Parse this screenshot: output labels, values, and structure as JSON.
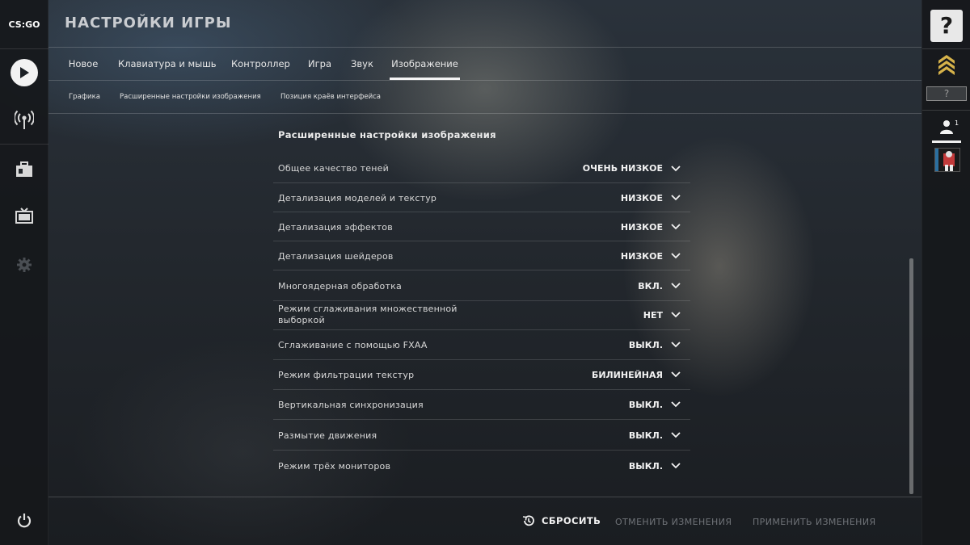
{
  "app": {
    "logo_text": "CS:GO",
    "title": "НАСТРОЙКИ ИГРЫ"
  },
  "sidebar": {
    "items": [
      {
        "name": "play",
        "icon": "play-icon"
      },
      {
        "name": "broadcast",
        "icon": "antenna-icon"
      },
      {
        "name": "inventory",
        "icon": "briefcase-icon"
      },
      {
        "name": "watch",
        "icon": "tv-icon"
      },
      {
        "name": "settings",
        "icon": "gear-icon"
      },
      {
        "name": "quit",
        "icon": "power-icon"
      }
    ]
  },
  "rightbar": {
    "help_label": "?",
    "rank_unknown": "?",
    "friends_count": "1"
  },
  "tabs": [
    {
      "label": "Новое",
      "active": false
    },
    {
      "label": "Клавиатура и мышь",
      "active": false
    },
    {
      "label": "Контроллер",
      "active": false
    },
    {
      "label": "Игра",
      "active": false
    },
    {
      "label": "Звук",
      "active": false
    },
    {
      "label": "Изображение",
      "active": true
    }
  ],
  "subtabs": [
    {
      "label": "Графика"
    },
    {
      "label": "Расширенные настройки изображения"
    },
    {
      "label": "Позиция краёв интерфейса"
    }
  ],
  "section": {
    "title": "Расширенные настройки изображения"
  },
  "settings": [
    {
      "label": "Общее качество теней",
      "value": "ОЧЕНЬ НИЗКОЕ"
    },
    {
      "label": "Детализация моделей и текстур",
      "value": "НИЗКОЕ"
    },
    {
      "label": "Детализация эффектов",
      "value": "НИЗКОЕ"
    },
    {
      "label": "Детализация шейдеров",
      "value": "НИЗКОЕ"
    },
    {
      "label": "Многоядерная обработка",
      "value": "ВКЛ."
    },
    {
      "label": "Режим сглаживания множественной выборкой",
      "value": "НЕТ"
    },
    {
      "label": "Сглаживание с помощью FXAA",
      "value": "ВЫКЛ."
    },
    {
      "label": "Режим фильтрации текстур",
      "value": "БИЛИНЕЙНАЯ"
    },
    {
      "label": "Вертикальная синхронизация",
      "value": "ВЫКЛ."
    },
    {
      "label": "Размытие движения",
      "value": "ВЫКЛ."
    },
    {
      "label": "Режим трёх мониторов",
      "value": "ВЫКЛ."
    }
  ],
  "footer": {
    "reset_label": "СБРОСИТЬ",
    "cancel_label": "ОТМЕНИТЬ ИЗМЕНЕНИЯ",
    "apply_label": "ПРИМЕНИТЬ ИЗМЕНЕНИЯ"
  },
  "colors": {
    "accent": "#f4f4f4",
    "disabled_text": "#6f7378"
  }
}
